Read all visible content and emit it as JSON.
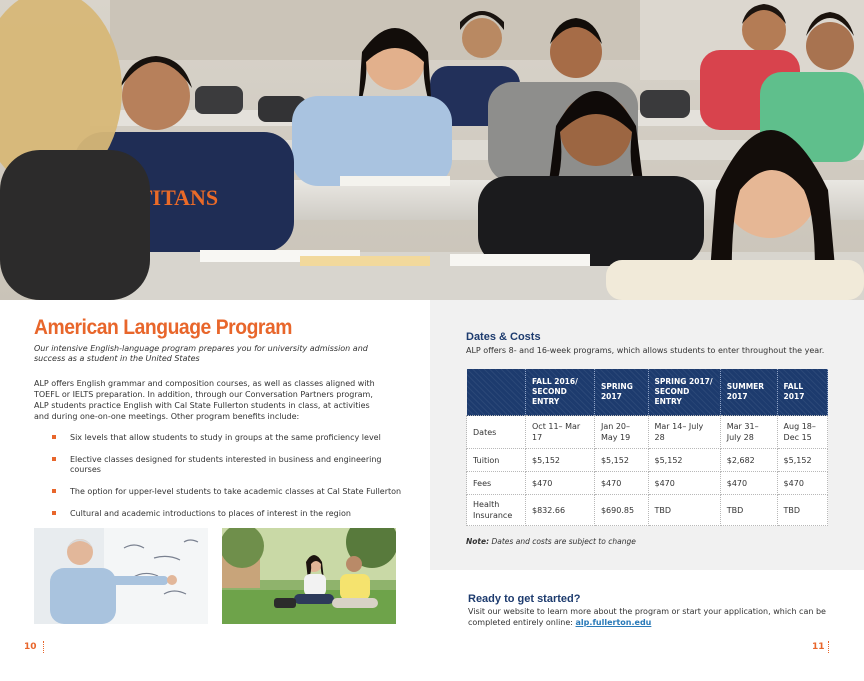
{
  "left_page": {
    "title": "American Language Program",
    "subtitle": "Our intensive English-language program prepares you for university admission and success as a student in the United States",
    "intro": "ALP offers English grammar and composition courses, as well as classes aligned with TOEFL or IELTS preparation. In addition, through our Conversation Partners program, ALP students practice English with Cal State Fullerton students in class, at activities and during one-on-one meetings. Other program benefits include:",
    "benefits": [
      "Six levels that allow students to study in groups at the same proficiency level",
      "Elective classes designed for students interested in business and engineering courses",
      "The option for upper-level students to take academic classes at Cal State Fullerton",
      "Cultural and academic introductions to places of interest in the region"
    ],
    "page_number": "10"
  },
  "hero": {
    "shirt_text": "TITANS"
  },
  "right_page": {
    "dates_heading": "Dates & Costs",
    "dates_intro": "ALP offers 8- and 16-week programs, which allows students to enter throughout the year.",
    "table": {
      "headers": [
        "FALL 2016/ SECOND ENTRY",
        "SPRING 2017",
        "SPRING 2017/ SECOND ENTRY",
        "SUMMER 2017",
        "FALL 2017"
      ],
      "rows": [
        {
          "label": "Dates",
          "values": [
            "Oct 11– Mar 17",
            "Jan 20– May 19",
            "Mar 14– July 28",
            "Mar 31– July 28",
            "Aug 18– Dec 15"
          ]
        },
        {
          "label": "Tuition",
          "values": [
            "$5,152",
            "$5,152",
            "$5,152",
            "$2,682",
            "$5,152"
          ]
        },
        {
          "label": "Fees",
          "values": [
            "$470",
            "$470",
            "$470",
            "$470",
            "$470"
          ]
        },
        {
          "label": "Health Insurance",
          "values": [
            "$832.66",
            "$690.85",
            "TBD",
            "TBD",
            "TBD"
          ]
        }
      ]
    },
    "note_label": "Note:",
    "note_text": "Dates and costs are subject to change",
    "ready_heading": "Ready to get started?",
    "ready_text": "Visit our website to learn more about the program or start your application, which can be completed entirely online:",
    "ready_link": "alp.fullerton.edu",
    "page_number": "11"
  },
  "colors": {
    "accent_orange": "#e8662b",
    "navy": "#1d3b6e",
    "link_blue": "#2a7ab8",
    "panel_gray": "#f1f1f1"
  }
}
